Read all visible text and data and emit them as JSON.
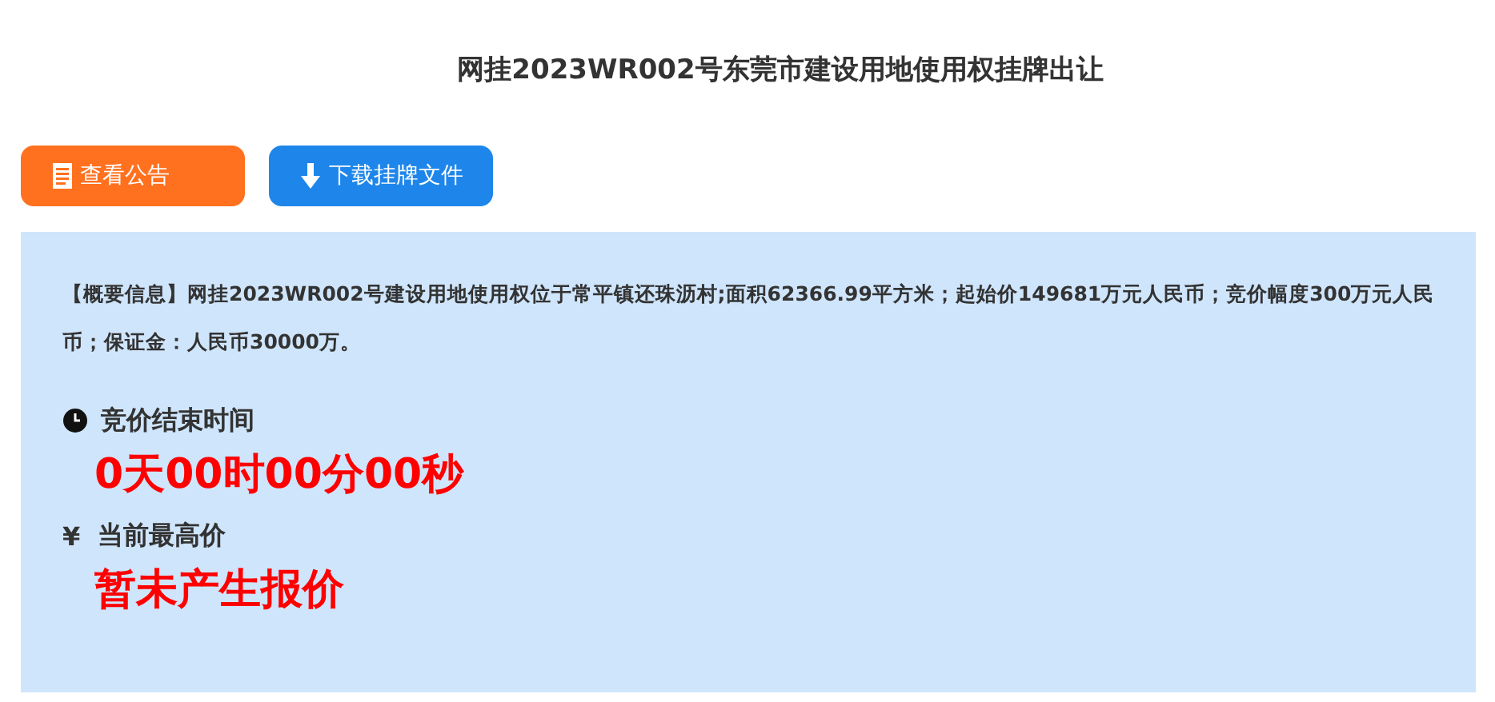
{
  "title": "网挂2023WR002号东莞市建设用地使用权挂牌出让",
  "buttons": [
    {
      "label": "查看公告",
      "kind": "notice"
    },
    {
      "label": "下载挂牌文件",
      "kind": "download"
    }
  ],
  "summary": "【概要信息】网挂2023WR002号建设用地使用权位于常平镇还珠沥村;面积62366.99平方米；起始价149681万元人民币；竞价幅度300万元人民币；保证金：人民币30000万。",
  "sections": [
    {
      "kind": "clock",
      "label": "竞价结束时间",
      "value": "0天00时00分00秒"
    },
    {
      "kind": "text",
      "icon_text": "¥",
      "label": "当前最高价",
      "value": "暂未产生报价"
    }
  ]
}
